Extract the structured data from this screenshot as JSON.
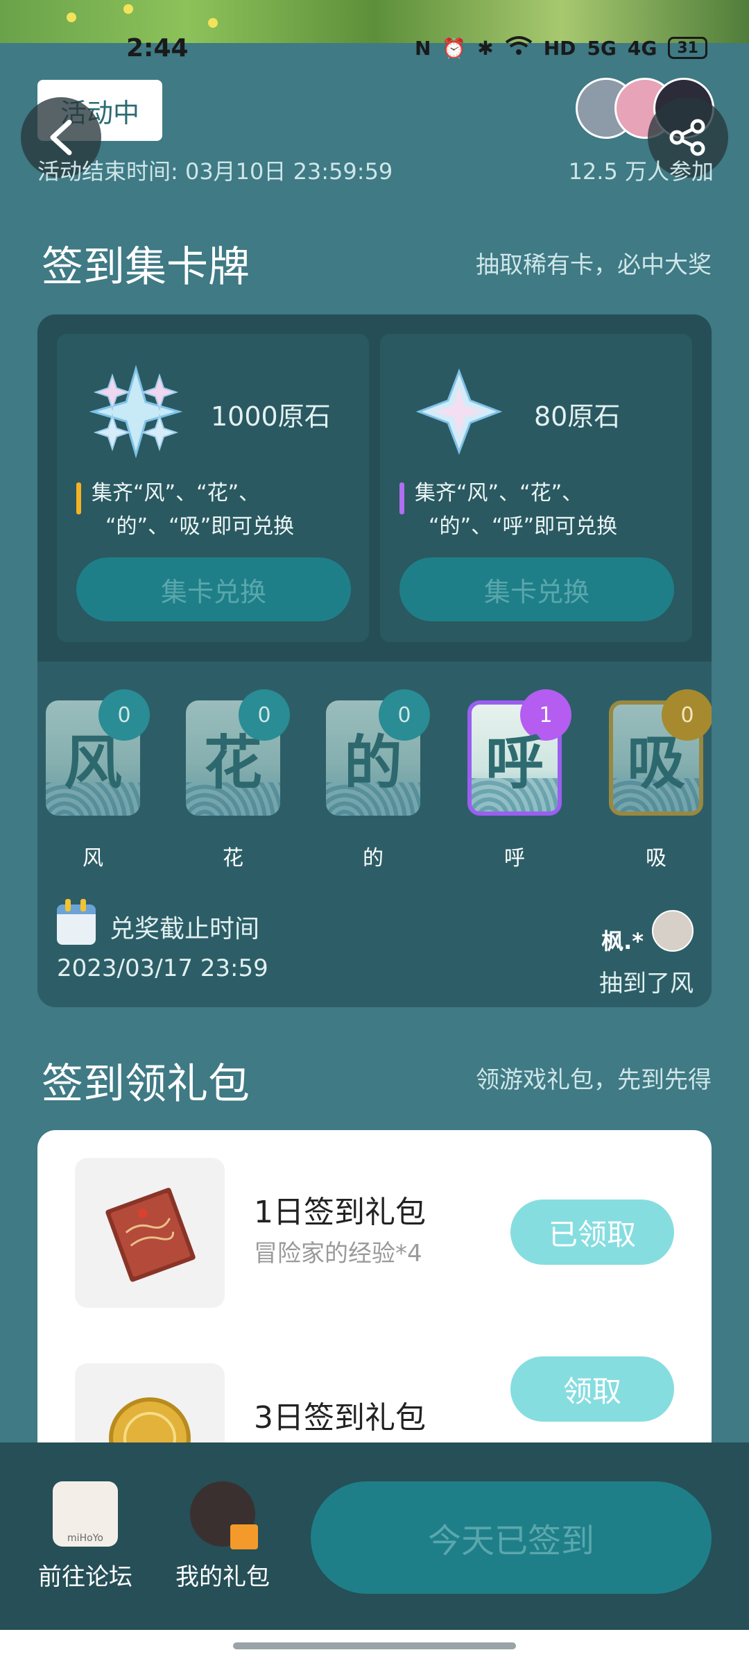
{
  "status_bar": {
    "time": "2:44",
    "network_5g": "5G",
    "network_4g": "4G",
    "hd": "HD",
    "battery": "31"
  },
  "header": {
    "status_chip": "活动中",
    "end_time": "活动结束时间: 03月10日 23:59:59",
    "participants": "12.5 万人参加"
  },
  "section_cards": {
    "title": "签到集卡牌",
    "subtitle": "抽取稀有卡，必中大奖",
    "rewards": [
      {
        "label": "1000原石",
        "requirement_line1": "集齐“风”、“花”、",
        "requirement_line2": "“的”、“吸”即可兑换",
        "button": "集卡兑换"
      },
      {
        "label": "80原石",
        "requirement_line1": "集齐“风”、“花”、",
        "requirement_line2": "“的”、“呼”即可兑换",
        "button": "集卡兑换"
      }
    ],
    "cards": [
      {
        "char": "风",
        "count": "0",
        "name": "风"
      },
      {
        "char": "花",
        "count": "0",
        "name": "花"
      },
      {
        "char": "的",
        "count": "0",
        "name": "的"
      },
      {
        "char": "呼",
        "count": "1",
        "name": "呼"
      },
      {
        "char": "吸",
        "count": "0",
        "name": "吸"
      }
    ],
    "deadline_label": "兑奖截止时间",
    "deadline_date": "2023/03/17 23:59",
    "winner_name": "枫.*",
    "winner_text": "抽到了风"
  },
  "section_gifts": {
    "title": "签到领礼包",
    "subtitle": "领游戏礼包，先到先得",
    "gifts": [
      {
        "title": "1日签到礼包",
        "desc": "冒险家的经验*4",
        "button": "已领取"
      },
      {
        "title": "3日签到礼包",
        "desc": "",
        "button": "领取"
      }
    ]
  },
  "bottom_bar": {
    "forum_label": "前往论坛",
    "forum_icon_text": "miHoYo",
    "gifts_label": "我的礼包",
    "signed_button": "今天已签到"
  },
  "colors": {
    "background": "#3f7a85",
    "panel": "#2d5e67",
    "accent_teal": "#1f7f88",
    "claim_button": "#86dde0",
    "gold": "#f3b324",
    "purple": "#b06ef0"
  }
}
